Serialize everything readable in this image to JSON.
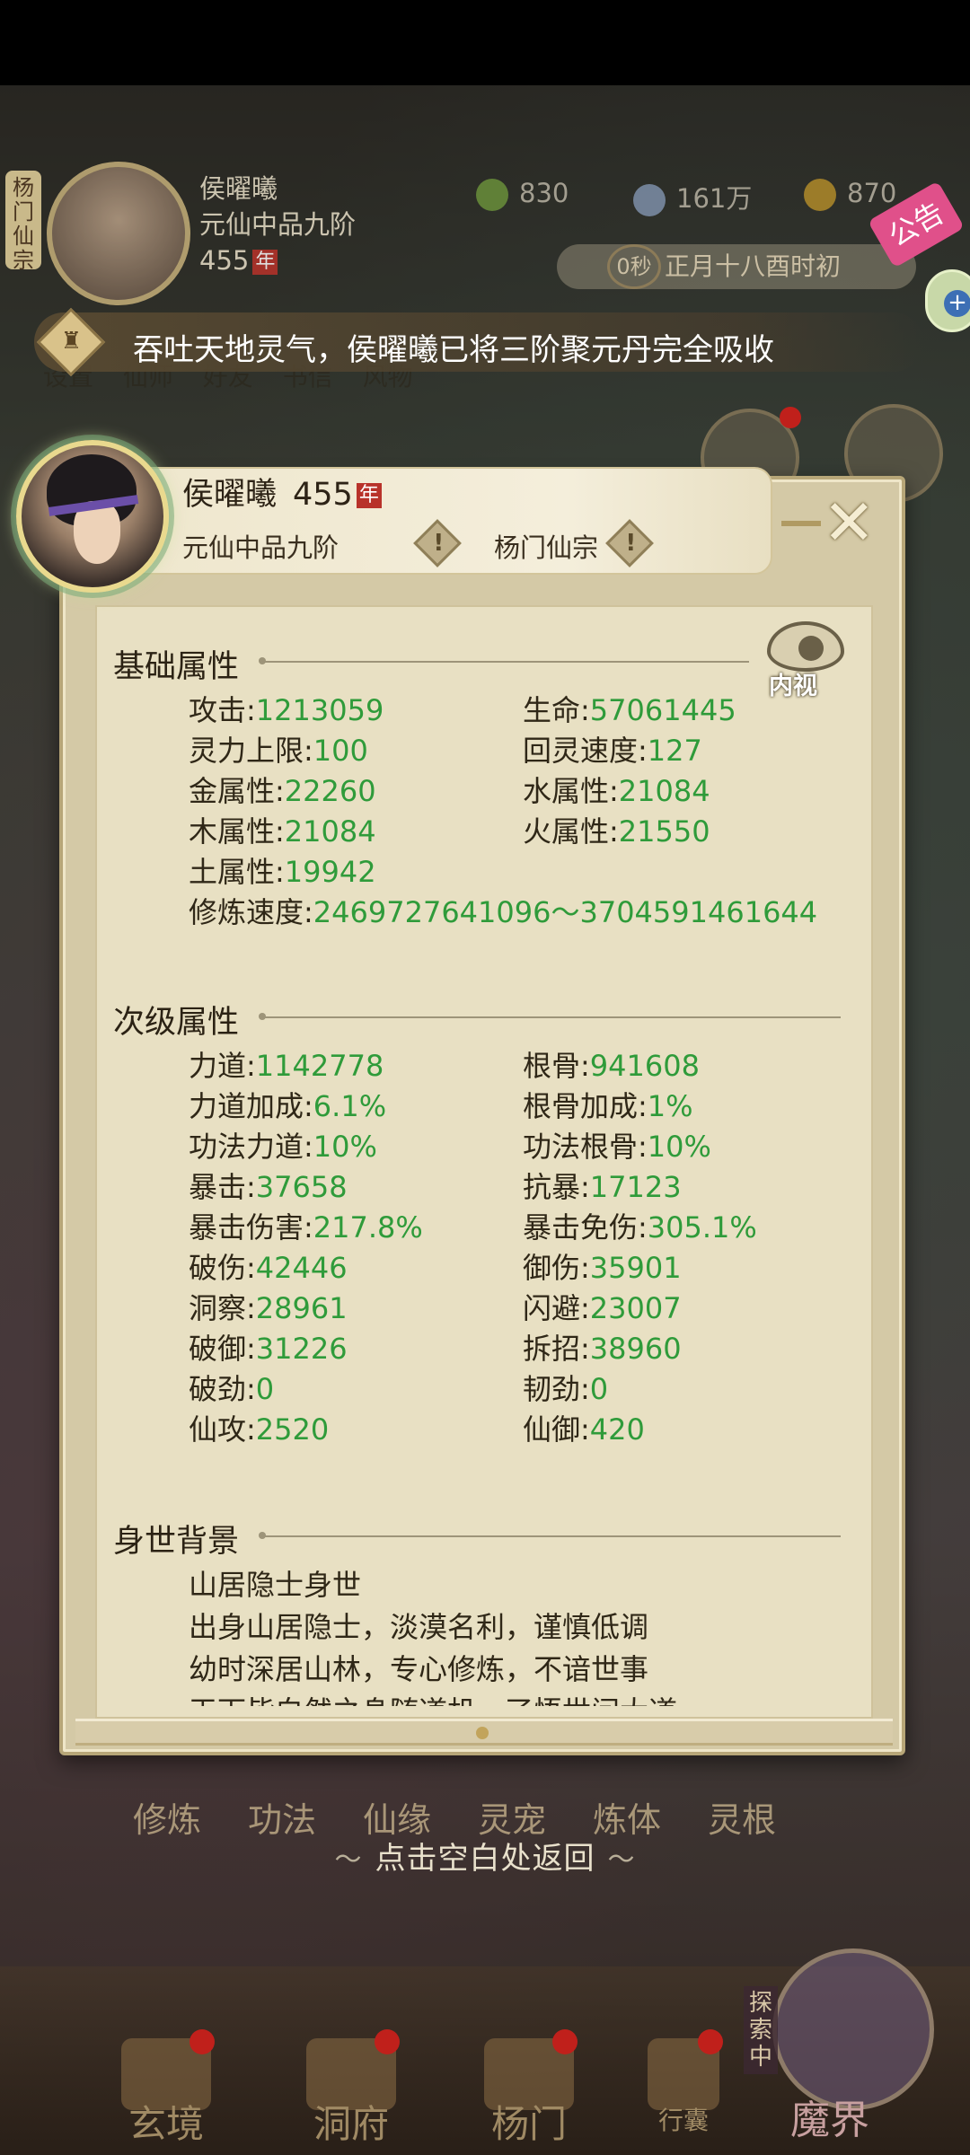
{
  "hud": {
    "sect_short": "杨门仙宗",
    "player_name": "侯曜曦",
    "player_rank": "元仙中品九阶",
    "player_age": "455",
    "age_unit": "年",
    "res_jade": "830",
    "res_coin": "161万",
    "res_gold": "870",
    "timer": "0秒",
    "date": "正月十八酉时初",
    "announce": "公告"
  },
  "notice": {
    "message": "吞吐天地灵气，侯曜曦已将三阶聚元丹完全吸收"
  },
  "bg_labels": "设置 仙师 好友 书信 风物",
  "panel": {
    "name": "侯曜曦",
    "age": "455",
    "age_unit": "年",
    "rank": "元仙中品九阶",
    "sect": "杨门仙宗",
    "inner_view": "内视"
  },
  "basic": {
    "title": "基础属性",
    "rows": [
      {
        "k": "攻击:",
        "v": "1213059"
      },
      {
        "k": "生命:",
        "v": "57061445"
      },
      {
        "k": "灵力上限:",
        "v": "100"
      },
      {
        "k": "回灵速度:",
        "v": "127"
      },
      {
        "k": "金属性:",
        "v": "22260"
      },
      {
        "k": "水属性:",
        "v": "21084"
      },
      {
        "k": "木属性:",
        "v": "21084"
      },
      {
        "k": "火属性:",
        "v": "21550"
      },
      {
        "k": "土属性:",
        "v": "19942"
      },
      {
        "k": "修炼速度:",
        "v": "2469727641096～3704591461644"
      }
    ]
  },
  "secondary": {
    "title": "次级属性",
    "rows": [
      {
        "k": "力道:",
        "v": "1142778"
      },
      {
        "k": "根骨:",
        "v": "941608"
      },
      {
        "k": "力道加成:",
        "v": "6.1%"
      },
      {
        "k": "根骨加成:",
        "v": "1%"
      },
      {
        "k": "功法力道:",
        "v": "10%"
      },
      {
        "k": "功法根骨:",
        "v": "10%"
      },
      {
        "k": "暴击:",
        "v": "37658"
      },
      {
        "k": "抗暴:",
        "v": "17123"
      },
      {
        "k": "暴击伤害:",
        "v": "217.8%"
      },
      {
        "k": "暴击免伤:",
        "v": "305.1%"
      },
      {
        "k": "破伤:",
        "v": "42446"
      },
      {
        "k": "御伤:",
        "v": "35901"
      },
      {
        "k": "洞察:",
        "v": "28961"
      },
      {
        "k": "闪避:",
        "v": "23007"
      },
      {
        "k": "破御:",
        "v": "31226"
      },
      {
        "k": "拆招:",
        "v": "38960"
      },
      {
        "k": "破劲:",
        "v": "0"
      },
      {
        "k": "韧劲:",
        "v": "0"
      },
      {
        "k": "仙攻:",
        "v": "2520"
      },
      {
        "k": "仙御:",
        "v": "420"
      }
    ]
  },
  "background": {
    "title": "身世背景",
    "lines": [
      "山居隐士身世",
      "出身山居隐士，淡漠名利，谨慎低调",
      "幼时深居山林，专心修炼，不谙世事",
      "天下皆白然之身随道机，了悟世间大道"
    ]
  },
  "bg_buttons": [
    "修炼",
    "功法",
    "仙缘",
    "灵宠",
    "炼体",
    "灵根"
  ],
  "return_hint": "点击空白处返回",
  "nav": {
    "items": [
      "玄境",
      "洞府",
      "杨门",
      "行囊"
    ],
    "explore": "探索中",
    "demon": "魔界"
  }
}
